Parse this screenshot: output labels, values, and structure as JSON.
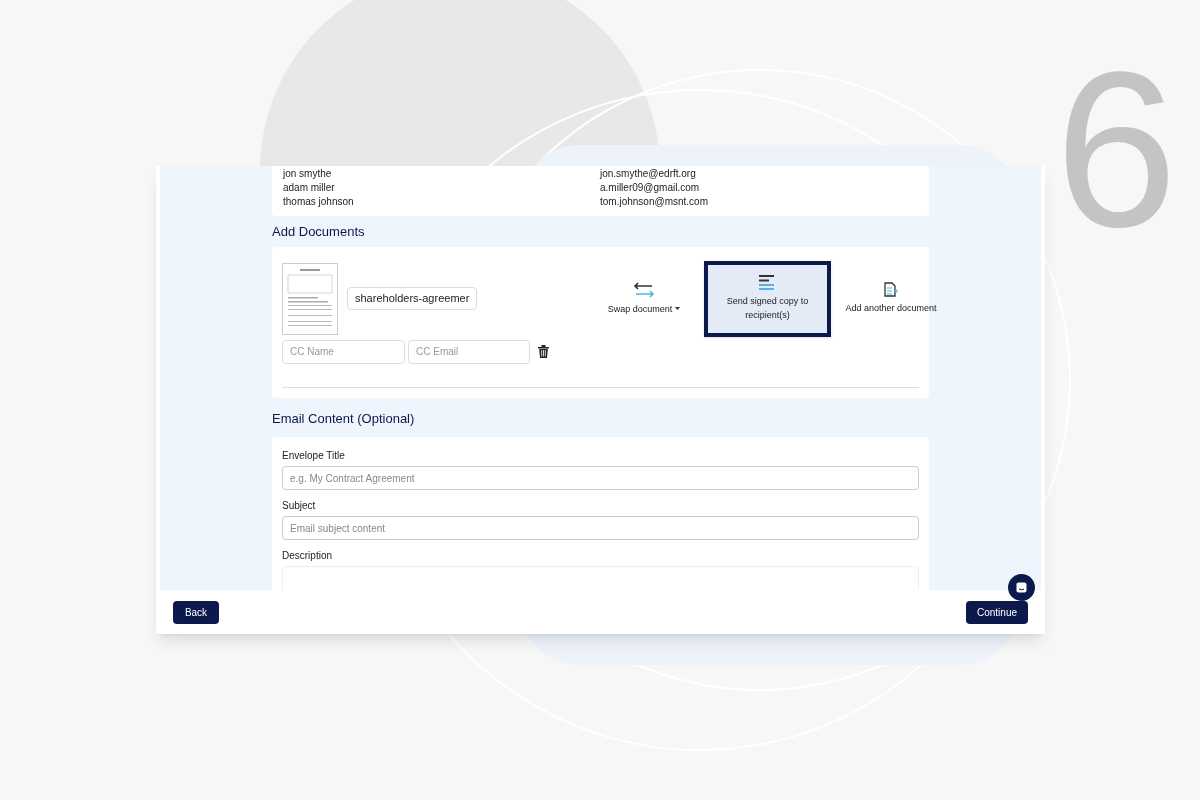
{
  "backdrop": {
    "step_number": "6"
  },
  "recipients": [
    {
      "name": "jon smythe",
      "email": "jon.smythe@edrft.org"
    },
    {
      "name": "adam miller",
      "email": "a.miller09@gmail.com"
    },
    {
      "name": "thomas johnson",
      "email": "tom.johnson@msnt.com"
    }
  ],
  "documents": {
    "heading": "Add Documents",
    "file_name": "shareholders-agreemer",
    "cc_name": {
      "placeholder": "CC Name"
    },
    "cc_email": {
      "placeholder": "CC Email"
    },
    "actions": [
      {
        "kind": "swap",
        "label": "Swap document",
        "selected": false
      },
      {
        "kind": "send",
        "label": "Send signed copy to recipient(s)",
        "selected": true
      },
      {
        "kind": "add",
        "label": "Add another document",
        "selected": false
      }
    ]
  },
  "email_content": {
    "heading": "Email Content (Optional)",
    "fields": [
      {
        "label": "Envelope Title",
        "placeholder": "e.g. My Contract Agreement"
      },
      {
        "label": "Subject",
        "placeholder": "Email subject content"
      },
      {
        "label": "Description",
        "kind": "textarea"
      }
    ]
  },
  "footer": {
    "back": "Back",
    "continue": "Continue"
  }
}
